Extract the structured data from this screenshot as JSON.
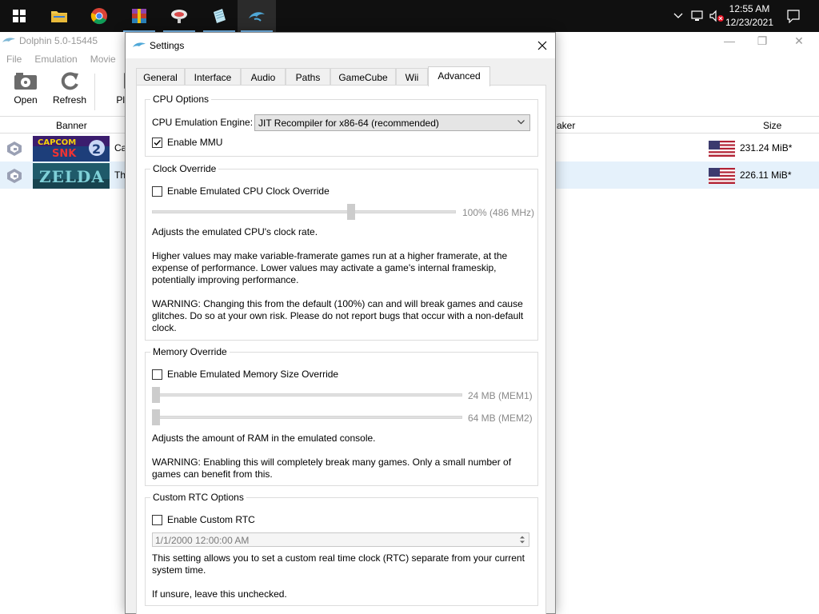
{
  "clock": {
    "time": "12:55 AM",
    "date": "12/23/2021"
  },
  "main_window": {
    "title": "Dolphin 5.0-15445",
    "menu": [
      "File",
      "Emulation",
      "Movie"
    ],
    "toolbar": {
      "open": "Open",
      "refresh": "Refresh",
      "play": "Play"
    },
    "columns": {
      "banner": "Banner",
      "maker": "aker",
      "size": "Size"
    },
    "games": [
      {
        "name": "Ca",
        "banner_text": "CAPCOM vs SNK 2 EO",
        "size": "231.24 MiB*"
      },
      {
        "name": "Th",
        "banner_text": "ZELDA",
        "size": "226.11 MiB*"
      }
    ]
  },
  "dialog": {
    "title": "Settings",
    "tabs": [
      "General",
      "Interface",
      "Audio",
      "Paths",
      "GameCube",
      "Wii",
      "Advanced"
    ],
    "active_tab": "Advanced",
    "cpu_options": {
      "title": "CPU Options",
      "engine_label": "CPU Emulation Engine:",
      "engine_value": "JIT Recompiler for x86-64 (recommended)",
      "mmu_label": "Enable MMU",
      "mmu_checked": true
    },
    "clock_override": {
      "title": "Clock Override",
      "checkbox_label": "Enable Emulated CPU Clock Override",
      "slider_value": "100% (486 MHz)",
      "slider_fraction": 0.66,
      "desc1": "Adjusts the emulated CPU's clock rate.",
      "desc2_lines": [
        "Higher values may make variable-framerate games run at a higher framerate, at the",
        "expense of performance. Lower values may activate a game's internal frameskip,",
        "potentially improving performance."
      ],
      "desc3_lines": [
        "WARNING: Changing this from the default (100%) can and will break games and cause",
        "glitches. Do so at your own risk. Please do not report bugs that occur with a non-default",
        "clock."
      ]
    },
    "memory_override": {
      "title": "Memory Override",
      "checkbox_label": "Enable Emulated Memory Size Override",
      "mem1_value": "24 MB (MEM1)",
      "mem2_value": "64 MB (MEM2)",
      "mem1_fraction": 0,
      "mem2_fraction": 0,
      "desc1": "Adjusts the amount of RAM in the emulated console.",
      "desc2_lines": [
        "WARNING: Enabling this will completely break many games. Only a small number of",
        "games can benefit from this."
      ]
    },
    "custom_rtc": {
      "title": "Custom RTC Options",
      "checkbox_label": "Enable Custom RTC",
      "datetime_value": "1/1/2000 12:00:00 AM",
      "desc1_lines": [
        "This setting allows you to set a custom real time clock (RTC) separate from your current",
        "system time."
      ],
      "desc2": "If unsure, leave this unchecked."
    }
  },
  "colors": {
    "accent": "#76b9ed",
    "selected_row": "#e5f1fb",
    "dolphin_icon": "#4fa8d8"
  }
}
